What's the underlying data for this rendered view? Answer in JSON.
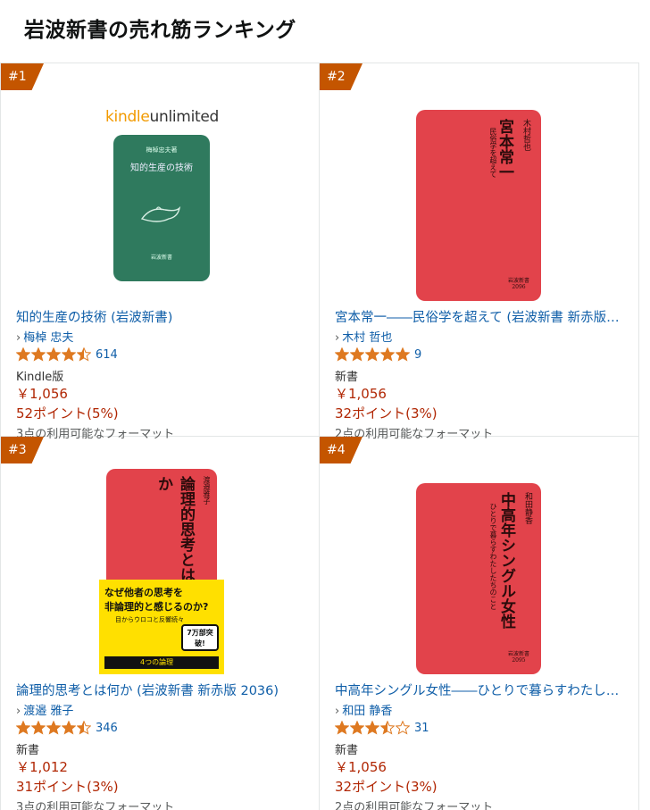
{
  "page": {
    "title": "岩波新書の売れ筋ランキング"
  },
  "icons": {
    "star_full": "star-full-icon",
    "star_half": "star-half-icon",
    "star_empty": "star-empty-icon"
  },
  "colors": {
    "rank_badge": "#c45500",
    "link": "#0f5ea8",
    "price": "#b12704",
    "star": "#de7921",
    "red_cover": "#e2434b",
    "green_cover": "#2f7a5e"
  },
  "items": [
    {
      "rank": "#1",
      "title": "知的生産の技術 (岩波新書)",
      "author": "梅棹 忠夫",
      "rating": 4.5,
      "rating_count": "614",
      "format": "Kindle版",
      "price": "￥1,056",
      "points": "52ポイント(5%)",
      "formats_available": "3点の利用可能なフォーマット",
      "cover": {
        "badge_a": "kindle",
        "badge_b": "unlimited",
        "main": "知的生産の技術",
        "author_line": "梅棹忠夫著",
        "footer": "岩波新書"
      }
    },
    {
      "rank": "#2",
      "title": "宮本常一――民俗学を超えて (岩波新書 新赤版…",
      "author": "木村 哲也",
      "rating": 5,
      "rating_count": "9",
      "format": "新書",
      "price": "￥1,056",
      "points": "32ポイント(3%)",
      "formats_available": "2点の利用可能なフォーマット",
      "cover": {
        "main": "宮本常一",
        "sub": "民俗学を超えて",
        "author_line": "木村哲也",
        "footer": "岩波新書 2096"
      }
    },
    {
      "rank": "#3",
      "title": "論理的思考とは何か (岩波新書 新赤版 2036)",
      "author": "渡邉 雅子",
      "rating": 4.5,
      "rating_count": "346",
      "format": "新書",
      "price": "￥1,012",
      "points": "31ポイント(3%)",
      "formats_available": "3点の利用可能なフォーマット",
      "cover": {
        "main": "論理的思考とは何か",
        "author_line": "渡邉雅子",
        "band_line1": "なぜ他者の思考を",
        "band_line2": "非論理的と感じるのか?",
        "band_line3": "目からウロコと反響続々",
        "band_badge": "7万部突破!",
        "band_line4": "4つの論理"
      }
    },
    {
      "rank": "#4",
      "title": "中高年シングル女性――ひとりで暮らすわたし…",
      "author": "和田 静香",
      "rating": 3.5,
      "rating_count": "31",
      "format": "新書",
      "price": "￥1,056",
      "points": "32ポイント(3%)",
      "formats_available": "2点の利用可能なフォーマット",
      "cover": {
        "main": "中高年シングル女性",
        "sub": "ひとりで暮らすわたしたちのこと",
        "author_line": "和田静香",
        "footer": "岩波新書 2095"
      }
    }
  ]
}
